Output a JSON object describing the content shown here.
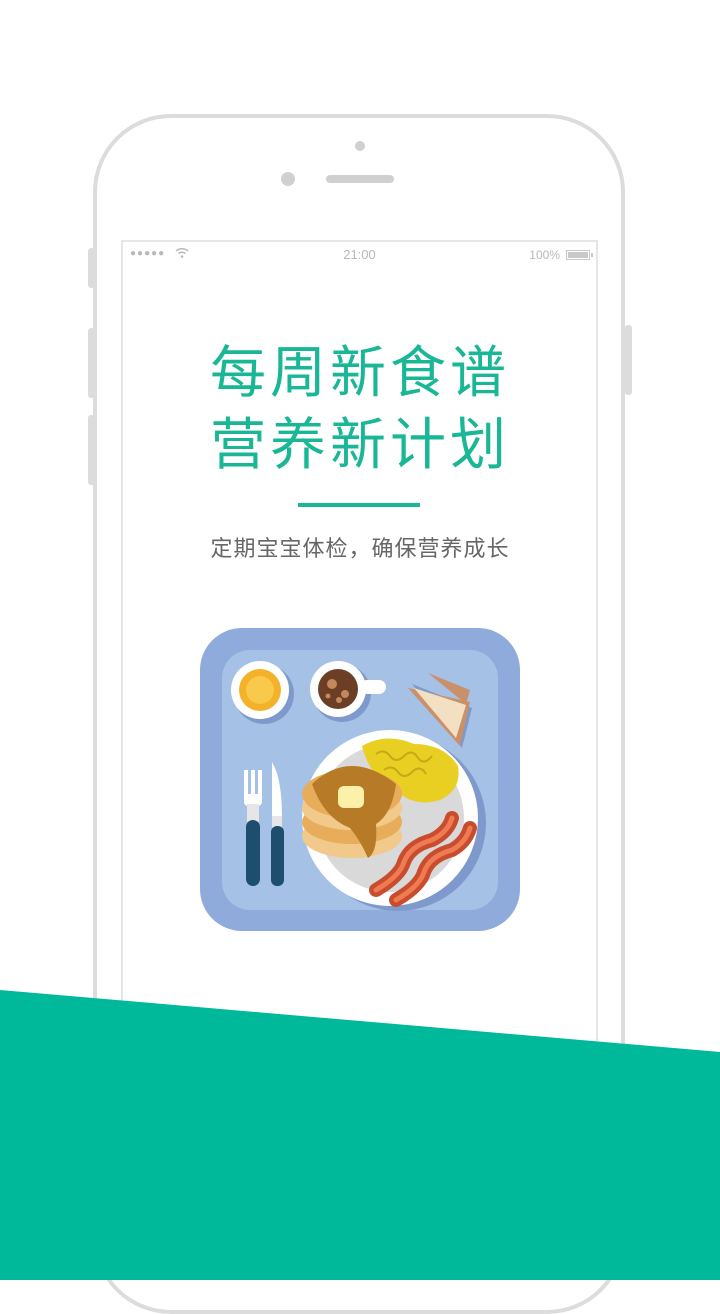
{
  "status_bar": {
    "signal": "●●●●●",
    "time": "21:00",
    "battery": "100%"
  },
  "headline": {
    "line1": "每周新食谱",
    "line2": "营养新计划"
  },
  "subtitle": "定期宝宝体检，确保营养成长",
  "colors": {
    "accent": "#19b795",
    "tray": "#8eabdc",
    "tray_inner": "#a6c1e6",
    "bottom_band": "#00b89a"
  },
  "illustration": "breakfast-tray-illustration"
}
